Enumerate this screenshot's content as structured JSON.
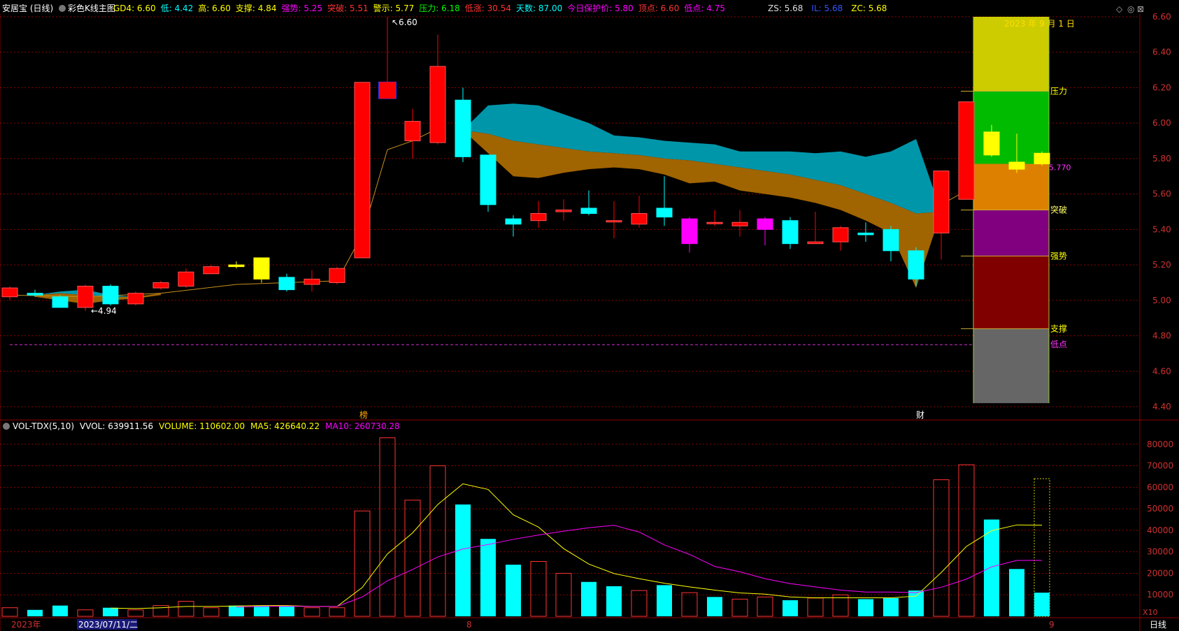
{
  "header": {
    "title": "安居宝 (日线)",
    "indicator_name": "彩色K线主图",
    "items": [
      {
        "label": "GD4:",
        "value": "6.60",
        "color": "#ffff00"
      },
      {
        "label": "低:",
        "value": "4.42",
        "color": "#00ffff"
      },
      {
        "label": "高:",
        "value": "6.60",
        "color": "#ffff00"
      },
      {
        "label": "支撑:",
        "value": "4.84",
        "color": "#ffff00"
      },
      {
        "label": "强势:",
        "value": "5.25",
        "color": "#ff00ff"
      },
      {
        "label": "突破:",
        "value": "5.51",
        "color": "#ff3333"
      },
      {
        "label": "警示:",
        "value": "5.77",
        "color": "#ffff00"
      },
      {
        "label": "压力:",
        "value": "6.18",
        "color": "#00ff00"
      },
      {
        "label": "低涨:",
        "value": "30.54",
        "color": "#ff3333"
      },
      {
        "label": "天数:",
        "value": "87.00",
        "color": "#00ffff"
      },
      {
        "label": "今日保护价:",
        "value": "5.80",
        "color": "#ff00ff"
      },
      {
        "label": "顶点:",
        "value": "6.60",
        "color": "#ff3333"
      },
      {
        "label": "低点:",
        "value": "4.75",
        "color": "#ff00ff"
      }
    ],
    "right_items": [
      {
        "label": "ZS:",
        "value": "5.68",
        "color": "#dddddd"
      },
      {
        "label": "IL:",
        "value": "5.68",
        "color": "#3355ff"
      },
      {
        "label": "ZC:",
        "value": "5.68",
        "color": "#ffff00"
      }
    ]
  },
  "vol_header": {
    "name": "VOL-TDX(5,10)",
    "vvol": "VVOL: 639911.56",
    "volume": "VOLUME: 110602.00",
    "ma5": "MA5: 426640.22",
    "ma10": "MA10: 260730.28"
  },
  "annotations": {
    "high_label": "6.60",
    "low_label": "4.94",
    "date_label": "2023 年 9 月 1 日",
    "right_price_label": "5.770",
    "marker_bang": "榜",
    "marker_cai": "财",
    "levels": [
      "压力",
      "突破",
      "强势",
      "支撑",
      "低点"
    ],
    "x10": "X10"
  },
  "bottom": {
    "year": "2023年",
    "date": "2023/07/11/二",
    "m8": "8",
    "m9": "9",
    "period": "日线"
  },
  "colors": {
    "up": "#ff0000",
    "down": "#00ffff",
    "grid": "#8b0000",
    "ma": "#c8901e",
    "vol_ma5": "#ffff00",
    "vol_ma10": "#ff00ff",
    "band_top": "#0096aa",
    "band_bottom": "#a06400"
  },
  "chart_data": [
    {
      "type": "candlestick",
      "ylim": [
        4.4,
        6.6
      ],
      "yticks": [
        "6.60",
        "6.40",
        "6.20",
        "6.00",
        "5.80",
        "5.60",
        "5.40",
        "5.20",
        "5.00",
        "4.80",
        "4.60",
        "4.40"
      ],
      "candles": [
        {
          "o": 5.02,
          "c": 5.07,
          "h": 5.08,
          "l": 5.0,
          "s": "up"
        },
        {
          "o": 5.04,
          "c": 5.03,
          "h": 5.06,
          "l": 5.02,
          "s": "down"
        },
        {
          "o": 5.02,
          "c": 4.96,
          "h": 5.03,
          "l": 4.96,
          "s": "down"
        },
        {
          "o": 4.96,
          "c": 5.08,
          "h": 5.09,
          "l": 4.94,
          "s": "up"
        },
        {
          "o": 5.08,
          "c": 4.98,
          "h": 5.09,
          "l": 4.97,
          "s": "down"
        },
        {
          "o": 4.98,
          "c": 5.04,
          "h": 5.05,
          "l": 4.97,
          "s": "up"
        },
        {
          "o": 5.07,
          "c": 5.1,
          "h": 5.11,
          "l": 5.06,
          "s": "up"
        },
        {
          "o": 5.08,
          "c": 5.16,
          "h": 5.18,
          "l": 5.07,
          "s": "up"
        },
        {
          "o": 5.15,
          "c": 5.19,
          "h": 5.2,
          "l": 5.15,
          "s": "up"
        },
        {
          "o": 5.2,
          "c": 5.19,
          "h": 5.22,
          "l": 5.18,
          "s": "yellow"
        },
        {
          "o": 5.24,
          "c": 5.12,
          "h": 5.24,
          "l": 5.1,
          "s": "yellow"
        },
        {
          "o": 5.13,
          "c": 5.06,
          "h": 5.15,
          "l": 5.05,
          "s": "down"
        },
        {
          "o": 5.09,
          "c": 5.12,
          "h": 5.17,
          "l": 5.05,
          "s": "up"
        },
        {
          "o": 5.1,
          "c": 5.18,
          "h": 5.19,
          "l": 5.09,
          "s": "up"
        },
        {
          "o": 5.24,
          "c": 6.23,
          "h": 6.23,
          "l": 5.24,
          "s": "up"
        },
        {
          "o": 6.14,
          "c": 6.23,
          "h": 6.6,
          "l": 6.14,
          "s": "blue"
        },
        {
          "o": 5.9,
          "c": 6.01,
          "h": 6.08,
          "l": 5.8,
          "s": "up"
        },
        {
          "o": 5.89,
          "c": 6.32,
          "h": 6.5,
          "l": 5.88,
          "s": "up"
        },
        {
          "o": 6.13,
          "c": 5.81,
          "h": 6.2,
          "l": 5.78,
          "s": "down"
        },
        {
          "o": 5.82,
          "c": 5.54,
          "h": 5.82,
          "l": 5.5,
          "s": "down"
        },
        {
          "o": 5.46,
          "c": 5.43,
          "h": 5.48,
          "l": 5.36,
          "s": "down"
        },
        {
          "o": 5.45,
          "c": 5.49,
          "h": 5.56,
          "l": 5.41,
          "s": "up"
        },
        {
          "o": 5.5,
          "c": 5.51,
          "h": 5.57,
          "l": 5.45,
          "s": "up"
        },
        {
          "o": 5.52,
          "c": 5.49,
          "h": 5.62,
          "l": 5.48,
          "s": "down"
        },
        {
          "o": 5.45,
          "c": 5.45,
          "h": 5.56,
          "l": 5.35,
          "s": "up"
        },
        {
          "o": 5.43,
          "c": 5.49,
          "h": 5.59,
          "l": 5.41,
          "s": "up"
        },
        {
          "o": 5.52,
          "c": 5.47,
          "h": 5.7,
          "l": 5.42,
          "s": "down"
        },
        {
          "o": 5.46,
          "c": 5.32,
          "h": 5.47,
          "l": 5.27,
          "s": "mag"
        },
        {
          "o": 5.44,
          "c": 5.44,
          "h": 5.51,
          "l": 5.42,
          "s": "up"
        },
        {
          "o": 5.42,
          "c": 5.44,
          "h": 5.51,
          "l": 5.36,
          "s": "up"
        },
        {
          "o": 5.46,
          "c": 5.4,
          "h": 5.47,
          "l": 5.31,
          "s": "mag"
        },
        {
          "o": 5.45,
          "c": 5.32,
          "h": 5.47,
          "l": 5.29,
          "s": "down"
        },
        {
          "o": 5.32,
          "c": 5.33,
          "h": 5.5,
          "l": 5.32,
          "s": "up"
        },
        {
          "o": 5.33,
          "c": 5.41,
          "h": 5.42,
          "l": 5.28,
          "s": "up"
        },
        {
          "o": 5.38,
          "c": 5.37,
          "h": 5.44,
          "l": 5.33,
          "s": "down"
        },
        {
          "o": 5.4,
          "c": 5.28,
          "h": 5.42,
          "l": 5.22,
          "s": "down"
        },
        {
          "o": 5.28,
          "c": 5.12,
          "h": 5.3,
          "l": 5.08,
          "s": "down"
        },
        {
          "o": 5.38,
          "c": 5.73,
          "h": 5.73,
          "l": 5.23,
          "s": "up"
        },
        {
          "o": 5.57,
          "c": 6.12,
          "h": 6.12,
          "l": 5.57,
          "s": "up"
        },
        {
          "o": 5.95,
          "c": 5.82,
          "h": 5.99,
          "l": 5.81,
          "s": "yellow"
        },
        {
          "o": 5.78,
          "c": 5.74,
          "h": 5.94,
          "l": 5.72,
          "s": "yellow"
        },
        {
          "o": 5.83,
          "c": 5.77,
          "h": 5.84,
          "l": 5.76,
          "s": "yellow"
        }
      ]
    },
    {
      "type": "bar",
      "title": "VOL-TDX(5,10)",
      "ylim": [
        0,
        90000
      ],
      "yticks": [
        80000,
        70000,
        60000,
        50000,
        40000,
        30000,
        20000,
        10000
      ],
      "values": [
        4000,
        3000,
        5000,
        3000,
        4000,
        3000,
        5000,
        7000,
        4000,
        5000,
        5000,
        5000,
        4000,
        4000,
        49000,
        83000,
        54000,
        70000,
        52000,
        36000,
        24000,
        25500,
        20000,
        16000,
        14000,
        12000,
        14500,
        11000,
        9000,
        8000,
        9000,
        7500,
        8500,
        10000,
        8000,
        8500,
        12000,
        63500,
        70500,
        45000,
        22000,
        11000
      ],
      "up": [
        true,
        false,
        false,
        true,
        false,
        true,
        true,
        true,
        true,
        false,
        false,
        false,
        true,
        true,
        true,
        true,
        true,
        true,
        false,
        false,
        false,
        true,
        true,
        false,
        false,
        true,
        false,
        true,
        false,
        true,
        true,
        false,
        true,
        true,
        false,
        false,
        false,
        true,
        true,
        false,
        false,
        false
      ],
      "ma5": [
        null,
        null,
        null,
        null,
        3800,
        3600,
        4000,
        4600,
        4600,
        4800,
        5000,
        5000,
        4600,
        4600,
        13400,
        29000,
        38800,
        52000,
        61600,
        59000,
        47200,
        41500,
        31500,
        24300,
        19900,
        17500,
        15400,
        13700,
        12200,
        10900,
        10300,
        9000,
        8600,
        8600,
        8600,
        8600,
        9400,
        20400,
        32500,
        39800,
        42500,
        42400
      ],
      "ma10": [
        null,
        null,
        null,
        null,
        null,
        null,
        null,
        null,
        null,
        4400,
        4600,
        4700,
        4600,
        4600,
        9000,
        16500,
        21800,
        27600,
        31300,
        33400,
        35800,
        37800,
        39600,
        41200,
        42300,
        39200,
        33200,
        28800,
        23200,
        20700,
        17500,
        15200,
        13700,
        12200,
        11300,
        11300,
        11000,
        13500,
        17300,
        23000,
        26000,
        26000
      ]
    }
  ]
}
